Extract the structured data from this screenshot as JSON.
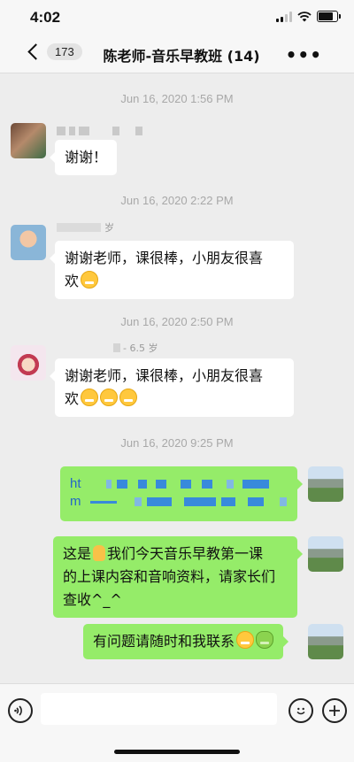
{
  "status_bar": {
    "time": "4:02"
  },
  "nav": {
    "back_badge": "173",
    "title": "陈老师-音乐早教班 (14)",
    "more_label": "•••"
  },
  "messages": [
    {
      "timestamp": "Jun 16, 2020 1:56 PM",
      "text": "谢谢！"
    },
    {
      "timestamp": "Jun 16, 2020 2:22 PM",
      "sender_suffix": "岁",
      "line1": "谢谢老师，课很棒，小朋友很喜",
      "line2": "欢"
    },
    {
      "timestamp": "Jun 16, 2020 2:50 PM",
      "sender_suffix": "- 6.5 岁",
      "line1": "谢谢老师，课很棒，小朋友很喜",
      "line2": "欢"
    },
    {
      "timestamp": "Jun 16, 2020 9:25 PM",
      "link_prefix_1": "ht",
      "link_prefix_2": "m"
    },
    {
      "line1_a": "这是",
      "line1_b": "我们今天音乐早教第一课",
      "line2": "的上课内容和音响资料，请家长们",
      "line3": "查收^_^"
    },
    {
      "text": "有问题请随时和我联系"
    }
  ],
  "input": {
    "placeholder": ""
  },
  "icons": {
    "voice": "voice-icon",
    "emoji": "emoji-icon",
    "add": "add-icon"
  },
  "colors": {
    "outgoing_bubble": "#95ec69",
    "incoming_bubble": "#ffffff",
    "background": "#ededed"
  }
}
